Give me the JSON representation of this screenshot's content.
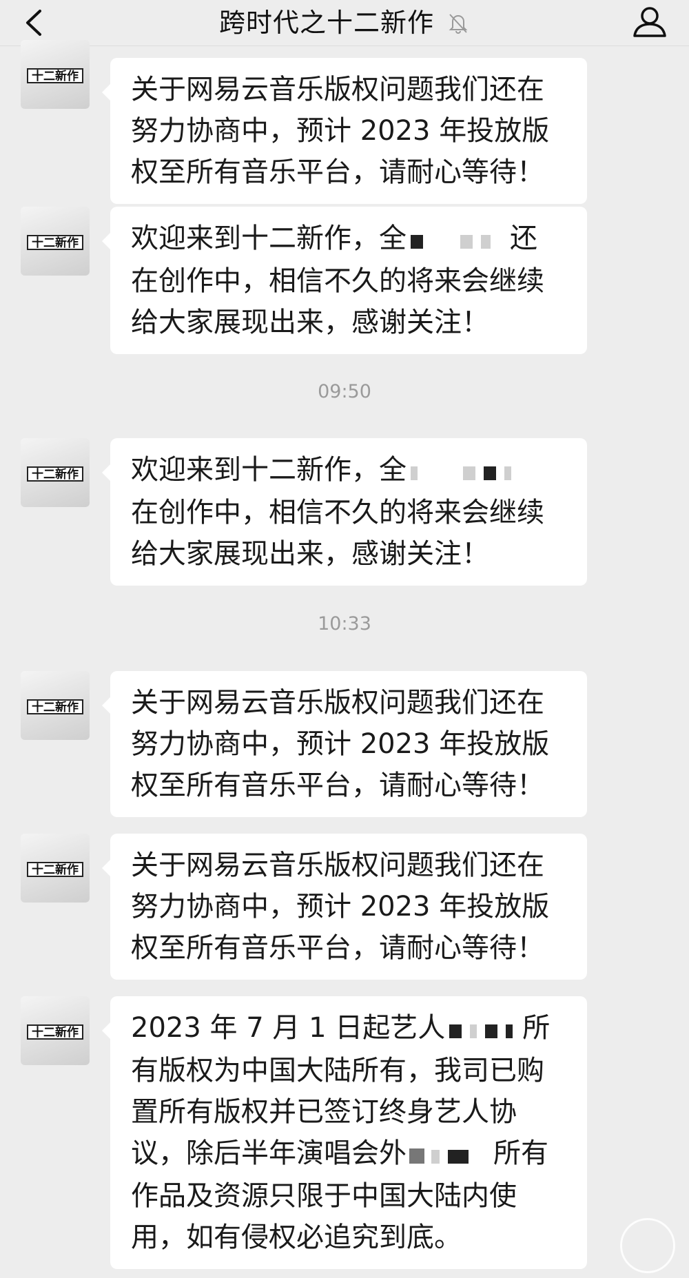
{
  "header": {
    "title": "跨时代之十二新作",
    "back_icon": "chevron-left-icon",
    "mute_icon": "bell-off-icon",
    "profile_icon": "person-icon"
  },
  "messages": [
    {
      "lines": [
        "关于网易云音乐版权问题我们还在",
        "努力协商中，预计 2023 年投放版",
        "权至所有音乐平台，请耐心等待！"
      ]
    },
    {
      "lines": [
        "欢迎来到十二新作，全",
        "还",
        "在创作中，相信不久的将来会继续",
        "给大家展现出来，感谢关注！"
      ]
    },
    {
      "lines": [
        "欢迎来到十二新作，全",
        "在创作中，相信不久的将来会继续",
        "给大家展现出来，感谢关注！"
      ]
    },
    {
      "lines": [
        "关于网易云音乐版权问题我们还在",
        "努力协商中，预计 2023 年投放版",
        "权至所有音乐平台，请耐心等待！"
      ]
    },
    {
      "lines": [
        "关于网易云音乐版权问题我们还在",
        "努力协商中，预计 2023 年投放版",
        "权至所有音乐平台，请耐心等待！"
      ]
    },
    {
      "lines": [
        "2023 年 7 月 1 日起艺人",
        "所",
        "有版权为中国大陆所有，我司已购",
        "置所有版权并已签订终身艺人协",
        "议，除后半年演唱会外",
        "所有",
        "作品及资源只限于中国大陆内使",
        "用，如有侵权必追究到底。"
      ]
    }
  ],
  "timestamps": {
    "t1": "09:50",
    "t2": "10:33"
  },
  "colors": {
    "background": "#ededed",
    "bubble": "#ffffff",
    "text": "#1a1a1a",
    "timestamp": "#9a9a9a"
  }
}
